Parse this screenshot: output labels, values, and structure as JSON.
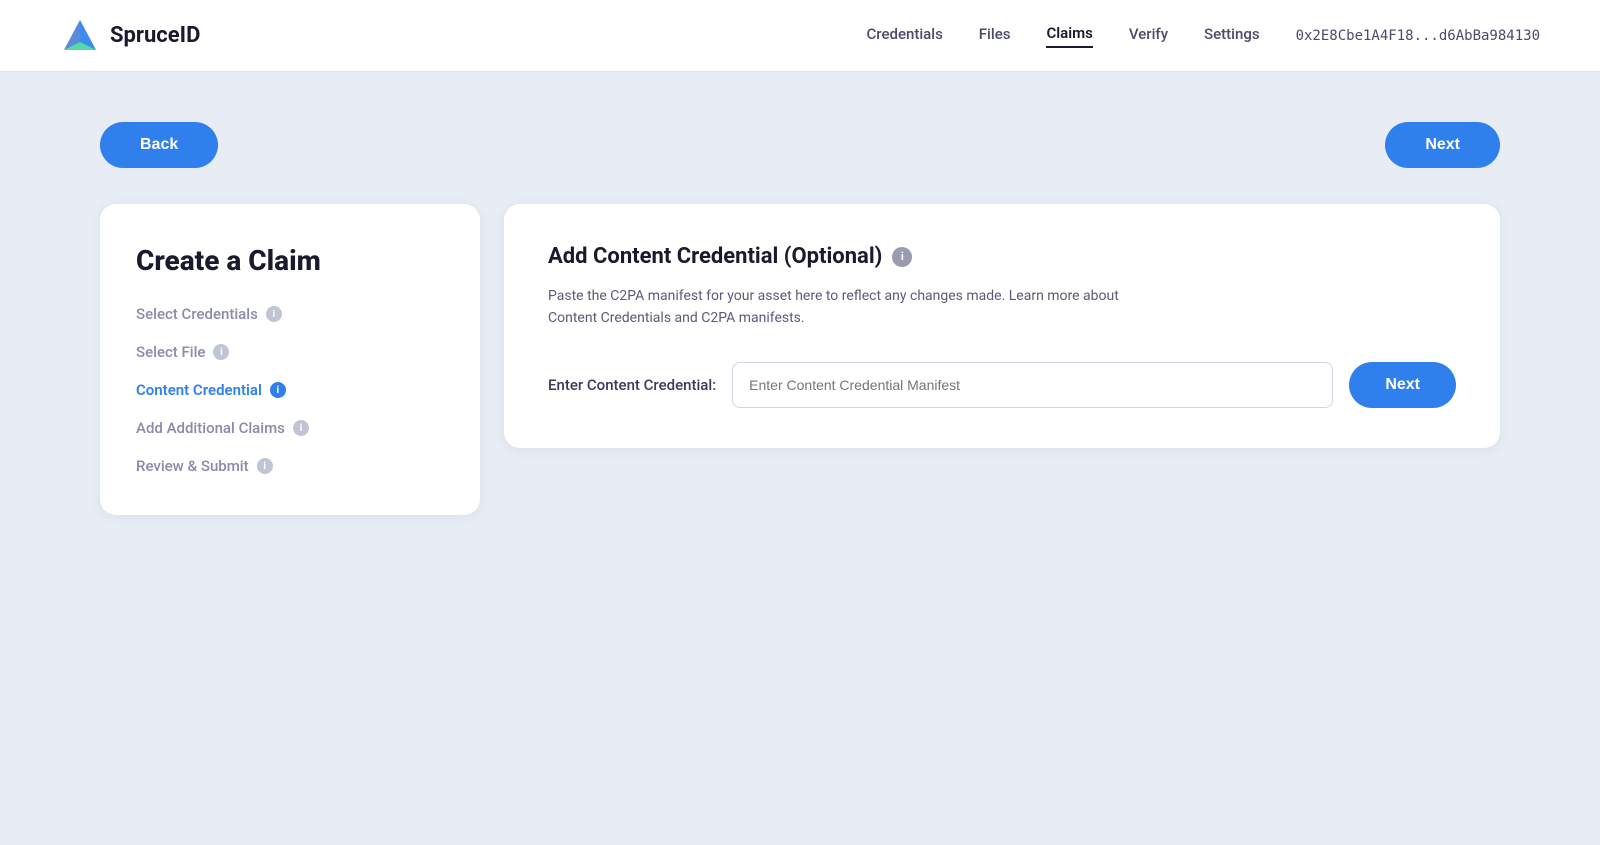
{
  "header": {
    "logo_text": "SpruceID",
    "nav_items": [
      {
        "label": "Credentials",
        "active": false
      },
      {
        "label": "Files",
        "active": false
      },
      {
        "label": "Claims",
        "active": true
      },
      {
        "label": "Verify",
        "active": false
      },
      {
        "label": "Settings",
        "active": false
      }
    ],
    "wallet_address": "0x2E8Cbe1A4F18...d6AbBa984130"
  },
  "top_actions": {
    "back_label": "Back",
    "next_label": "Next"
  },
  "left_card": {
    "title": "Create a Claim",
    "steps": [
      {
        "label": "Select Credentials",
        "active": false
      },
      {
        "label": "Select File",
        "active": false
      },
      {
        "label": "Content Credential",
        "active": true
      },
      {
        "label": "Add Additional Claims",
        "active": false
      },
      {
        "label": "Review & Submit",
        "active": false
      }
    ]
  },
  "right_card": {
    "title": "Add Content Credential (Optional)",
    "description": "Paste the C2PA manifest for your asset here to reflect any changes made. Learn more about Content Credentials and C2PA manifests.",
    "form_label": "Enter Content Credential:",
    "input_placeholder": "Enter Content Credential Manifest",
    "next_label": "Next"
  },
  "icons": {
    "info": "i"
  }
}
